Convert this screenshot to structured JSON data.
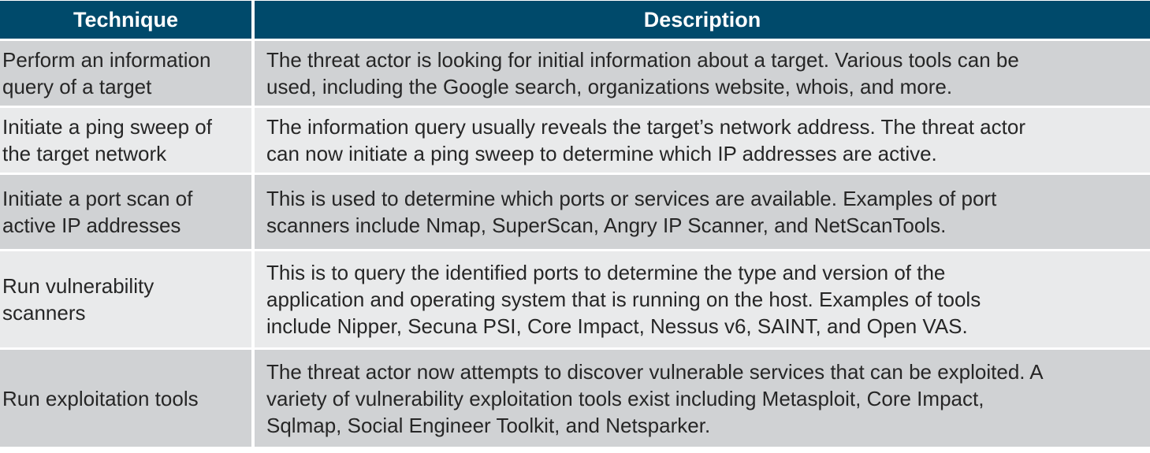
{
  "table": {
    "headers": {
      "technique": "Technique",
      "description": "Description"
    },
    "rows": [
      {
        "technique": "Perform an information\nquery of a target",
        "description": "The threat actor is looking for initial information about a target. Various tools can be\nused, including the Google search, organizations website, whois, and more."
      },
      {
        "technique": "Initiate a ping sweep of\nthe target network",
        "description": "The information query usually reveals the target’s network address. The threat actor\ncan now initiate a ping sweep to determine which IP addresses are active."
      },
      {
        "technique": "Initiate a port scan of\nactive IP addresses",
        "description": "This is used to determine which ports or services are available. Examples of port\nscanners include Nmap, SuperScan, Angry IP Scanner, and NetScanTools."
      },
      {
        "technique": "Run vulnerability\nscanners",
        "description": "This is to query the identified ports to determine the type and version of the\napplication and operating system that is running on the host. Examples of tools\ninclude Nipper, Secuna PSI, Core Impact, Nessus v6, SAINT, and Open VAS."
      },
      {
        "technique": "Run exploitation tools",
        "description": "The threat actor now attempts to discover vulnerable services that can be exploited. A\nvariety of vulnerability exploitation tools exist including Metasploit, Core Impact,\nSqlmap, Social Engineer Toolkit, and Netsparker."
      }
    ]
  },
  "colors": {
    "header_bg": "#004a6b",
    "row_odd_bg": "#d0d2d4",
    "row_even_bg": "#e9eaeb"
  }
}
